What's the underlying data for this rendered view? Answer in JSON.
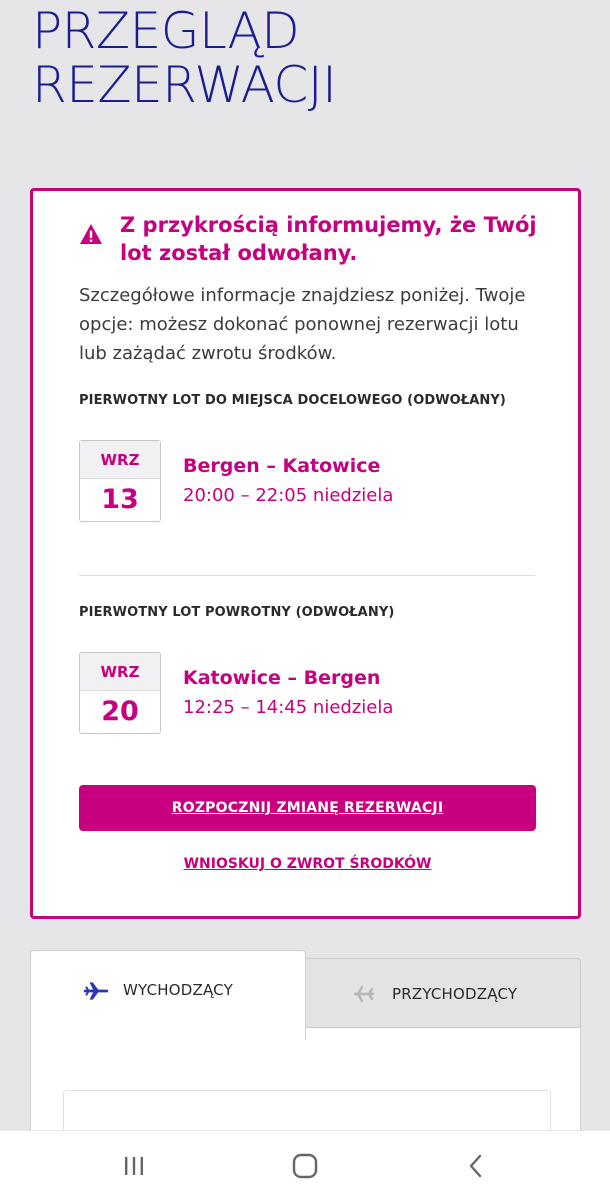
{
  "page": {
    "title_line1": "PRZEGLĄD",
    "title_line2": "REZERWACJI"
  },
  "alert": {
    "icon": "warning-icon",
    "title": "Z przykrością informujemy, że Twój lot został odwołany.",
    "body": "Szczegółowe informacje znajdziesz poniżej. Twoje opcje: możesz dokonać ponownej rezerwacji lotu lub zażądać zwrotu środków.",
    "outbound": {
      "label": "PIERWOTNY LOT DO MIEJSCA DOCELOWEGO (ODWOŁANY)",
      "month": "WRZ",
      "day": "13",
      "route": "Bergen – Katowice",
      "times": "20:00 – 22:05 niedziela"
    },
    "return": {
      "label": "PIERWOTNY LOT POWROTNY (ODWOŁANY)",
      "month": "WRZ",
      "day": "20",
      "route": "Katowice – Bergen",
      "times": "12:25 – 14:45 niedziela"
    },
    "primary_button": "ROZPOCZNIJ ZMIANĘ REZERWACJI",
    "refund_link": "WNIOSKUJ O ZWROT ŚRODKÓW"
  },
  "tabs": [
    {
      "label": "WYCHODZĄCY",
      "icon": "plane-departure-icon",
      "active": true
    },
    {
      "label": "PRZYCHODZĄCY",
      "icon": "plane-arrival-icon",
      "active": false
    }
  ],
  "navbar": {
    "icons": [
      "recent-apps-icon",
      "home-icon",
      "back-icon"
    ]
  },
  "colors": {
    "brand_magenta": "#c6007e",
    "title_navy": "#1a1d8f",
    "tab_icon_blue": "#2a35b8"
  }
}
